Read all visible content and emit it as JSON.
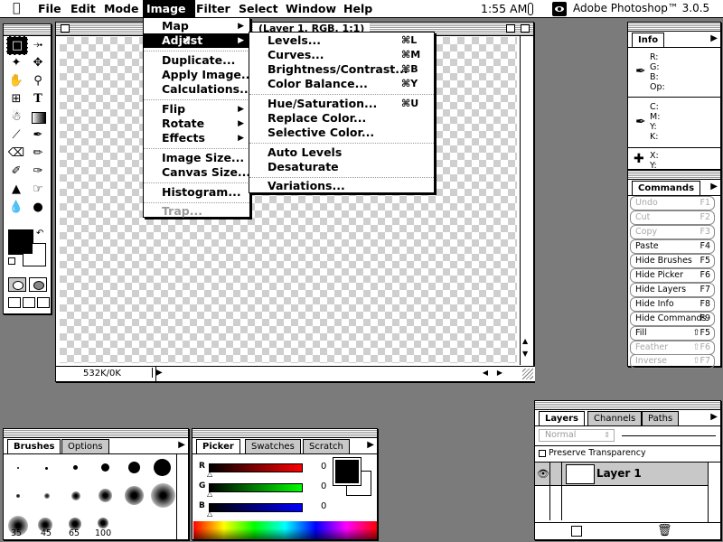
{
  "menubar": {
    "items": [
      "File",
      "Edit",
      "Mode",
      "Image",
      "Filter",
      "Select",
      "Window",
      "Help"
    ],
    "clock": "1:55 AM",
    "app_name": "Adobe Photoshop™ 3.0.5"
  },
  "image_menu": {
    "items": [
      {
        "label": "Map",
        "submenu": true
      },
      {
        "label": "Adjust",
        "submenu": true,
        "highlighted": true
      },
      {
        "label": "Duplicate..."
      },
      {
        "label": "Apply Image..."
      },
      {
        "label": "Calculations..."
      },
      {
        "label": "Flip",
        "submenu": true
      },
      {
        "label": "Rotate",
        "submenu": true
      },
      {
        "label": "Effects",
        "submenu": true
      },
      {
        "label": "Image Size..."
      },
      {
        "label": "Canvas Size..."
      },
      {
        "label": "Histogram..."
      },
      {
        "label": "Trap...",
        "disabled": true
      }
    ]
  },
  "adjust_menu": {
    "items": [
      {
        "label": "Levels...",
        "shortcut": "⌘L"
      },
      {
        "label": "Curves...",
        "shortcut": "⌘M"
      },
      {
        "label": "Brightness/Contrast...",
        "shortcut": "⌘B"
      },
      {
        "label": "Color Balance...",
        "shortcut": "⌘Y"
      },
      {
        "label": "Hue/Saturation...",
        "shortcut": "⌘U"
      },
      {
        "label": "Replace Color...",
        "shortcut": ""
      },
      {
        "label": "Selective Color...",
        "shortcut": ""
      },
      {
        "label": "Auto Levels",
        "shortcut": ""
      },
      {
        "label": "Desaturate",
        "shortcut": ""
      },
      {
        "label": "Variations...",
        "shortcut": ""
      }
    ]
  },
  "document": {
    "title": "(Layer 1, RGB, 1:1)",
    "status": "532K/0K"
  },
  "info_palette": {
    "tab": "Info",
    "rgb_labels": [
      "R:",
      "G:",
      "B:",
      "Op:"
    ],
    "cmyk_labels": [
      "C:",
      "M:",
      "Y:",
      "K:"
    ],
    "xy_labels": [
      "X:",
      "Y:"
    ]
  },
  "commands_palette": {
    "tab": "Commands",
    "items": [
      {
        "name": "Undo",
        "key": "F1",
        "disabled": true
      },
      {
        "name": "Cut",
        "key": "F2",
        "disabled": true
      },
      {
        "name": "Copy",
        "key": "F3",
        "disabled": true
      },
      {
        "name": "Paste",
        "key": "F4"
      },
      {
        "name": "Hide Brushes",
        "key": "F5"
      },
      {
        "name": "Hide Picker",
        "key": "F6"
      },
      {
        "name": "Hide Layers",
        "key": "F7"
      },
      {
        "name": "Hide Info",
        "key": "F8"
      },
      {
        "name": "Hide Commands",
        "key": "F9"
      },
      {
        "name": "Fill",
        "key": "⇧F5"
      },
      {
        "name": "Feather",
        "key": "⇧F6",
        "disabled": true
      },
      {
        "name": "Inverse",
        "key": "⇧F7",
        "disabled": true
      }
    ]
  },
  "brushes_palette": {
    "tabs": [
      "Brushes",
      "Options"
    ],
    "size_labels": [
      "35",
      "45",
      "65",
      "100"
    ]
  },
  "picker_palette": {
    "tabs": [
      "Picker",
      "Swatches",
      "Scratch"
    ],
    "channels": [
      {
        "label": "R",
        "value": "0"
      },
      {
        "label": "G",
        "value": "0"
      },
      {
        "label": "B",
        "value": "0"
      }
    ]
  },
  "layers_palette": {
    "tabs": [
      "Layers",
      "Channels",
      "Paths"
    ],
    "mode": "Normal",
    "preserve_label": "Preserve Transparency",
    "layer_name": "Layer 1"
  }
}
